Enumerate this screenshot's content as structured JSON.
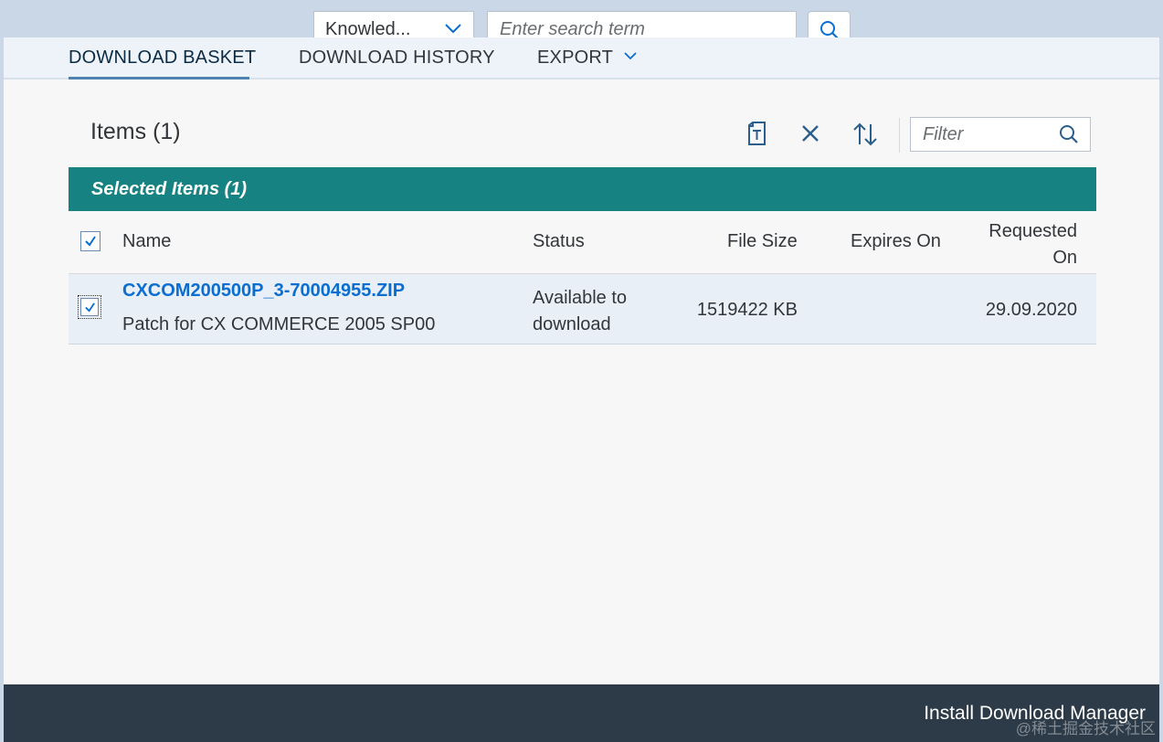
{
  "search": {
    "scope_value": "Knowled...",
    "placeholder": "Enter search term"
  },
  "tabs": [
    {
      "label": "DOWNLOAD BASKET",
      "active": true
    },
    {
      "label": "DOWNLOAD HISTORY",
      "active": false
    },
    {
      "label": "EXPORT",
      "active": false
    }
  ],
  "items": {
    "title": "Items (1)",
    "filter_placeholder": "Filter",
    "group_header": "Selected Items (1)"
  },
  "table": {
    "columns": {
      "name": "Name",
      "status": "Status",
      "file_size": "File Size",
      "expires_on": "Expires On",
      "requested_on_line1": "Requested",
      "requested_on_line2": "On"
    },
    "rows": [
      {
        "file_name": "CXCOM200500P_3-70004955.ZIP",
        "description": "Patch for CX COMMERCE 2005 SP00",
        "status_line1": "Available to",
        "status_line2": "download",
        "file_size": "1519422 KB",
        "expires_on": "",
        "requested_on": "29.09.2020",
        "selected": true
      }
    ]
  },
  "footer": {
    "install_label": "Install Download Manager"
  },
  "watermark": "@稀土掘金技术社区",
  "colors": {
    "accent_teal": "#168281",
    "link_blue": "#0a6ed1",
    "footer_bg": "#2d3a47"
  }
}
